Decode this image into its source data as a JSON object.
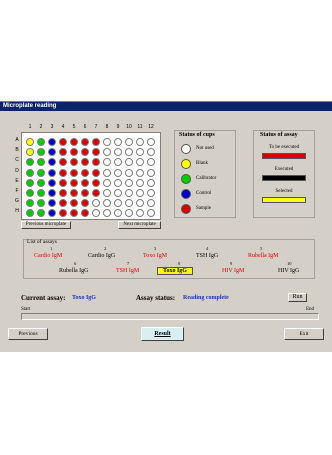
{
  "window": {
    "title": "Microplate reading"
  },
  "plate": {
    "columns": [
      "1",
      "2",
      "3",
      "4",
      "5",
      "6",
      "7",
      "8",
      "9",
      "10",
      "11",
      "12"
    ],
    "rows": [
      "A",
      "B",
      "C",
      "D",
      "E",
      "F",
      "G",
      "H"
    ]
  },
  "buttons": {
    "previous_microplate": "Previous microplate",
    "next_microplate": "Next microplate",
    "run": "Run",
    "previous": "Previous",
    "result": "Result",
    "exit": "Exit"
  },
  "cups_status": {
    "title": "Status of cups",
    "items": [
      {
        "label": "Not used",
        "color": "#ffffff"
      },
      {
        "label": "Blank",
        "color": "#ffff00"
      },
      {
        "label": "Calibrator",
        "color": "#00cc00"
      },
      {
        "label": "Control",
        "color": "#0000cc"
      },
      {
        "label": "Sample",
        "color": "#dd0000"
      }
    ]
  },
  "assay_status_panel": {
    "title": "Status of assay",
    "items": [
      {
        "label": "To be executed",
        "color": "#dd0000"
      },
      {
        "label": "Executed",
        "color": "#000000"
      },
      {
        "label": "Selected",
        "color": "#ffff00"
      }
    ]
  },
  "assays": {
    "title": "List of assays",
    "items": [
      {
        "num": "1",
        "name": "Cardio IgM",
        "color": "#dd0000"
      },
      {
        "num": "2",
        "name": "Cardio IgG",
        "color": "#000000"
      },
      {
        "num": "3",
        "name": "Toxo IgM",
        "color": "#dd0000"
      },
      {
        "num": "4",
        "name": "TSH IgG",
        "color": "#000000"
      },
      {
        "num": "5",
        "name": "Rubella IgM",
        "color": "#dd0000"
      },
      {
        "num": "6",
        "name": "Rubella IgG",
        "color": "#000000"
      },
      {
        "num": "7",
        "name": "TSH IgM",
        "color": "#dd0000"
      },
      {
        "num": "8",
        "name": "Toxo IgG",
        "color": "#000000",
        "selected": true
      },
      {
        "num": "9",
        "name": "HIV IgM",
        "color": "#dd0000"
      },
      {
        "num": "10",
        "name": "HIV IgG",
        "color": "#000000"
      }
    ]
  },
  "status": {
    "current_assay_label": "Current assay:",
    "current_assay_value": "Toxo IgG",
    "assay_status_label": "Assay status:",
    "assay_status_value": "Reading complete"
  },
  "progress": {
    "start_label": "Start",
    "end_label": "End"
  }
}
